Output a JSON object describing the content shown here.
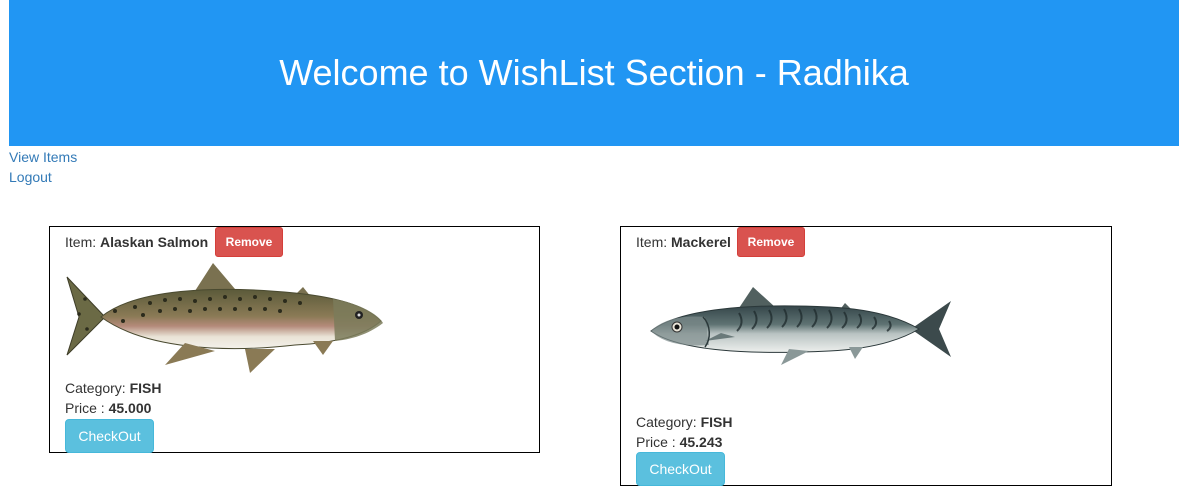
{
  "header": {
    "title": "Welcome to WishList Section - Radhika"
  },
  "nav": {
    "view_items": "View Items",
    "logout": "Logout"
  },
  "items": [
    {
      "item_label": "Item: ",
      "name": "Alaskan Salmon",
      "remove_label": "Remove",
      "image_icon": "salmon-fish-image",
      "category_label": "Category: ",
      "category": "FISH",
      "price_label": "Price : ",
      "price": "45.000",
      "checkout_label": "CheckOut"
    },
    {
      "item_label": "Item: ",
      "name": "Mackerel",
      "remove_label": "Remove",
      "image_icon": "mackerel-fish-image",
      "category_label": "Category: ",
      "category": "FISH",
      "price_label": "Price : ",
      "price": "45.243",
      "checkout_label": "CheckOut"
    }
  ],
  "colors": {
    "banner": "#2196f3",
    "remove": "#d9534f",
    "checkout": "#5bc0de",
    "link": "#337ab7"
  }
}
